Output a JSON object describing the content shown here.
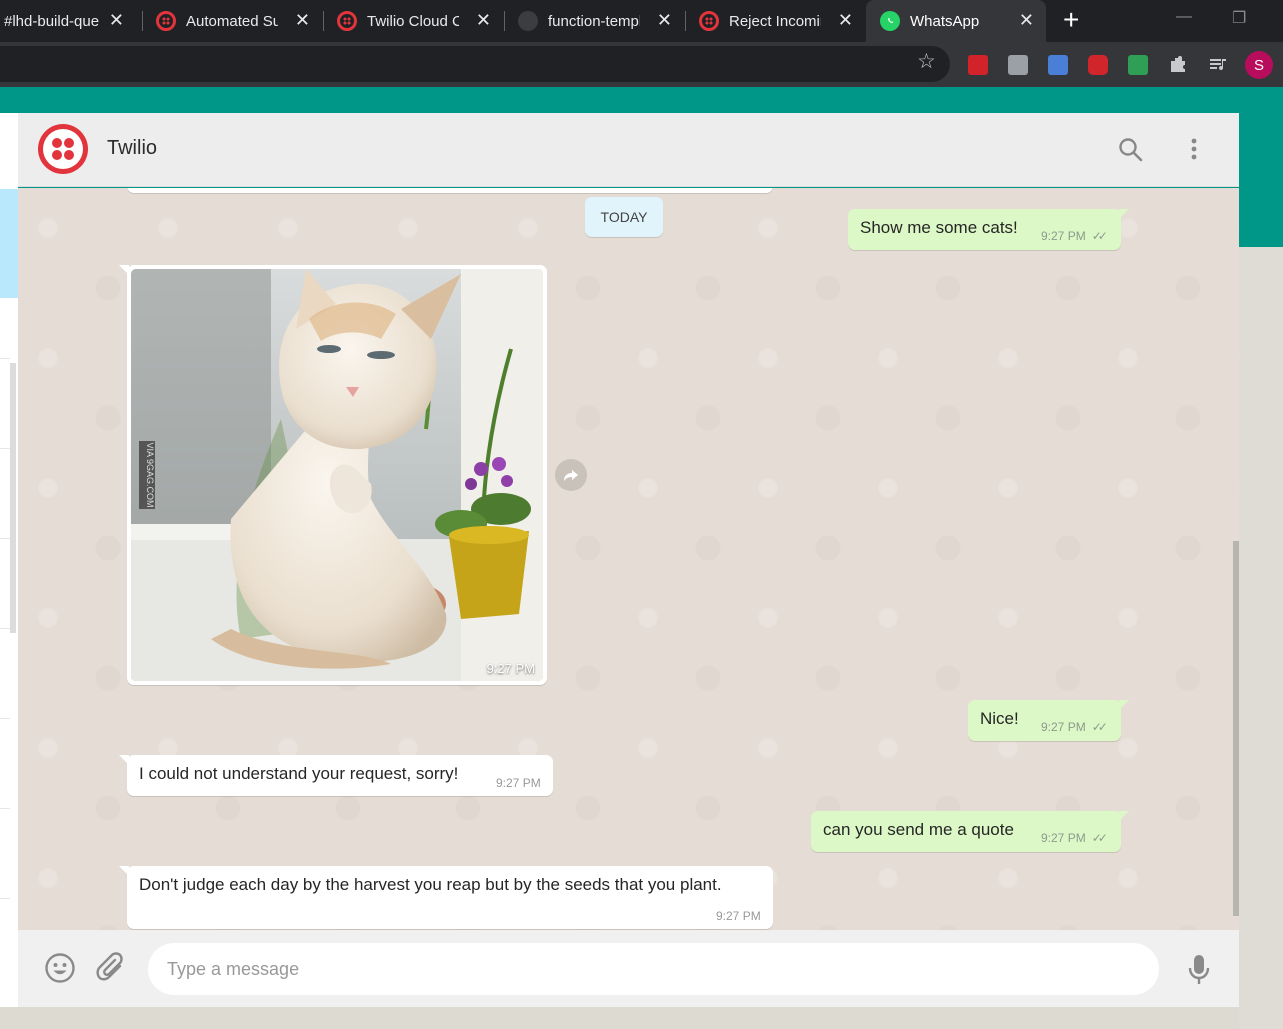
{
  "browser": {
    "tabs": [
      {
        "title": "#lhd-build-que",
        "icon": "hash-favicon"
      },
      {
        "title": "Automated Sur",
        "icon": "twilio-favicon"
      },
      {
        "title": "Twilio Cloud Co",
        "icon": "twilio-favicon"
      },
      {
        "title": "function-templ",
        "icon": "github-favicon"
      },
      {
        "title": "Reject Incoming",
        "icon": "twilio-favicon"
      },
      {
        "title": "WhatsApp",
        "icon": "whatsapp-favicon"
      }
    ],
    "new_tab_glyph": "+",
    "close_glyph": "✕",
    "profile_initial": "S",
    "bookmark_glyph": "☆"
  },
  "chat": {
    "contact_name": "Twilio",
    "date_divider": "TODAY",
    "messages": [
      {
        "direction": "out",
        "text": "Show me some cats!",
        "time": "9:27 PM"
      },
      {
        "direction": "in",
        "type": "image",
        "caption_time": "9:27 PM",
        "watermark": "VIA 9GAG.COM"
      },
      {
        "direction": "out",
        "text": "Nice!",
        "time": "9:27 PM"
      },
      {
        "direction": "in",
        "text": "I could not understand your request, sorry!",
        "time": "9:27 PM"
      },
      {
        "direction": "out",
        "text": "can you send me a quote",
        "time": "9:27 PM"
      },
      {
        "direction": "in",
        "text": "Don't judge each day by the harvest you reap but by the seeds that you plant.",
        "time": "9:27 PM"
      }
    ],
    "read_ticks": "✓✓"
  },
  "composer": {
    "placeholder": "Type a message"
  },
  "colors": {
    "teal": "#009688",
    "outgoing_bubble": "#dcf8c6",
    "incoming_bubble": "#ffffff",
    "twilio_red": "#e2343c"
  }
}
